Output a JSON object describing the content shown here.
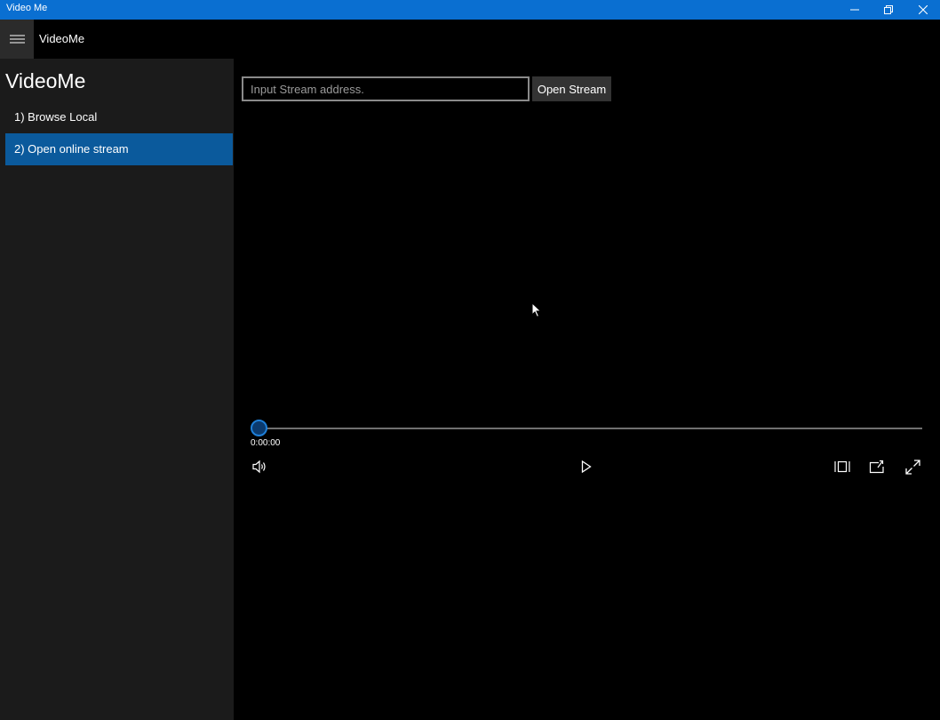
{
  "window": {
    "title": "Video Me",
    "controls": {
      "minimize_icon": "minimize-icon",
      "restore_icon": "restore-icon",
      "close_icon": "close-icon"
    }
  },
  "header": {
    "menu_icon": "hamburger-icon",
    "title": "VideoMe"
  },
  "sidebar": {
    "heading": "VideoMe",
    "items": [
      {
        "label": "1) Browse Local",
        "selected": false
      },
      {
        "label": "2) Open online stream",
        "selected": true
      }
    ],
    "selected_color": "#0b5a9c"
  },
  "stream": {
    "placeholder": "Input Stream address.",
    "value": "",
    "open_label": "Open Stream"
  },
  "player": {
    "time": "0:00:00",
    "progress": 0,
    "controls": [
      "volume-icon",
      "play-icon",
      "aspect-ratio-icon",
      "cast-icon",
      "fullscreen-icon"
    ]
  },
  "colors": {
    "titlebar": "#0a6fd1",
    "accent": "#0b78d7",
    "sidebar_bg": "#1b1b1b",
    "main_bg": "#000000"
  }
}
